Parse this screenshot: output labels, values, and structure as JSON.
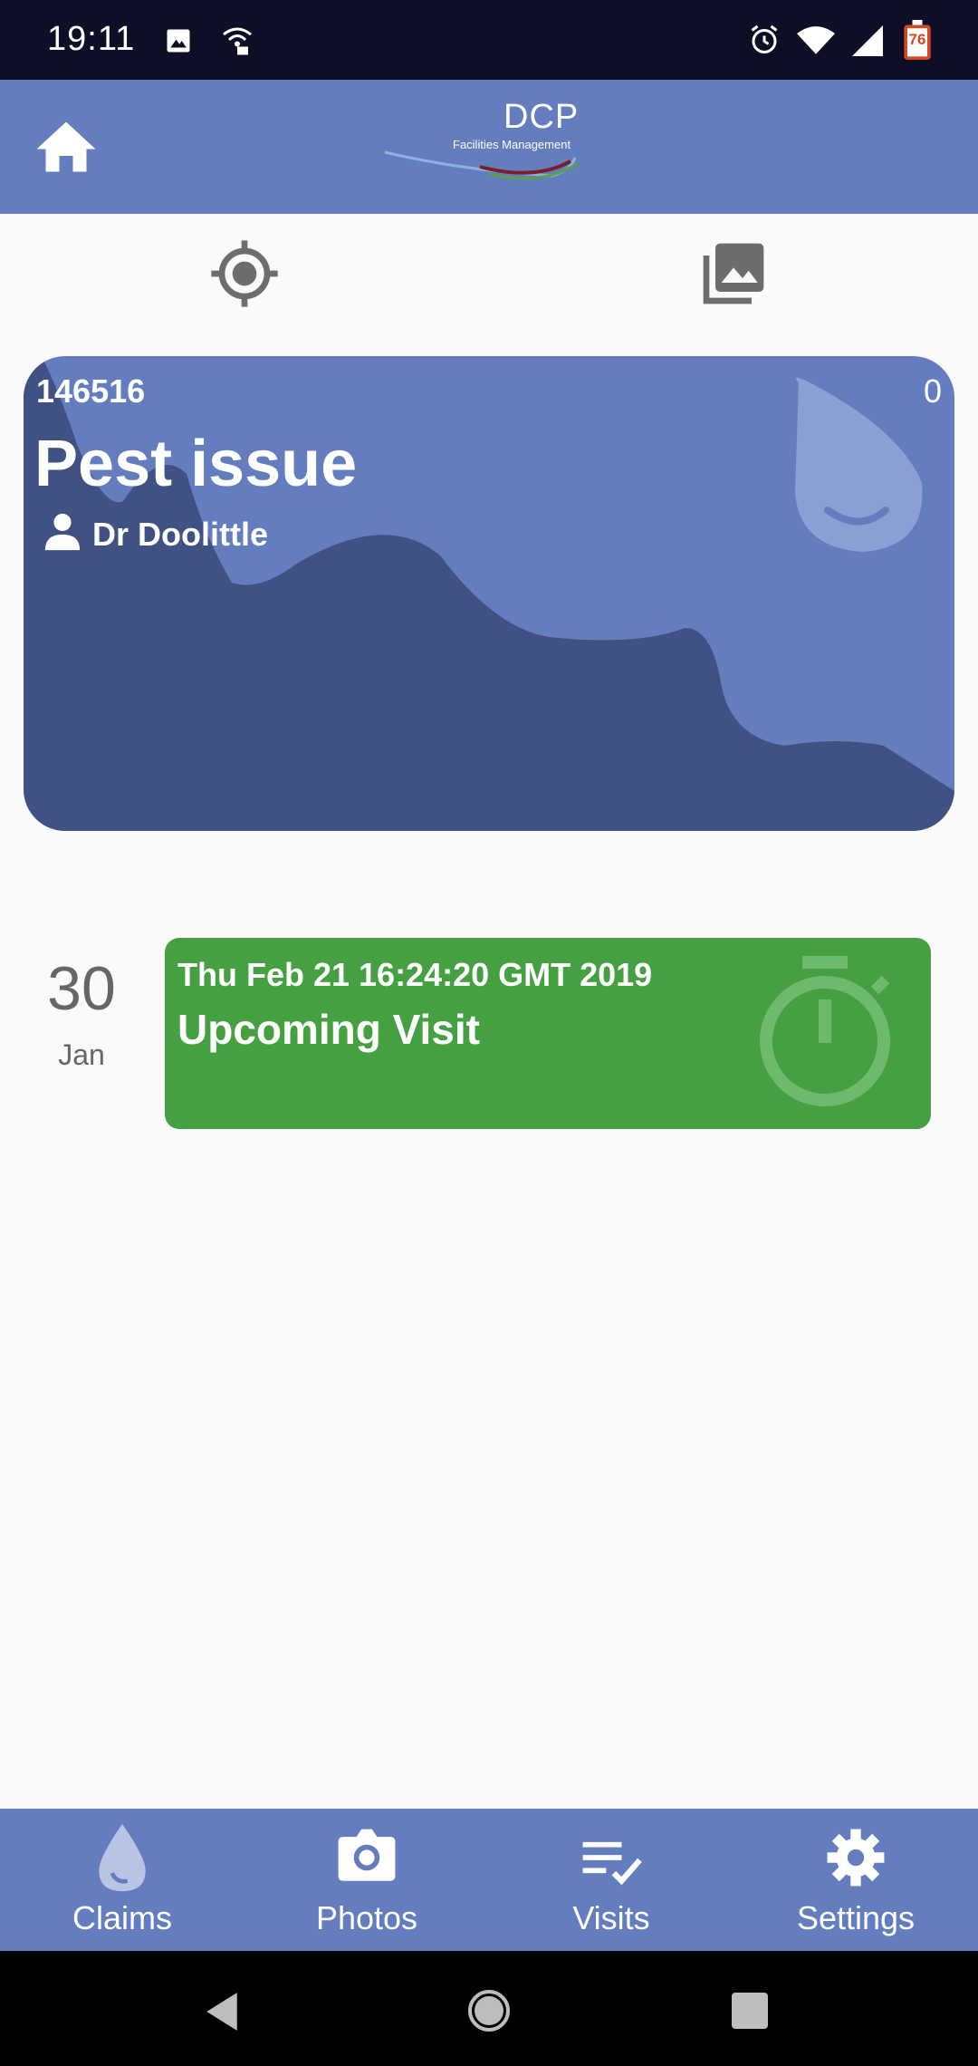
{
  "status_bar": {
    "time": "19:11",
    "battery_level": "76",
    "icons": [
      "image-icon",
      "wifi-calling-icon",
      "alarm-icon",
      "wifi-icon",
      "signal-icon",
      "battery-icon"
    ]
  },
  "app_bar": {
    "home_icon": "home-icon",
    "logo_title": "DCP",
    "logo_subtitle": "Facilities Management"
  },
  "toolbar": {
    "icons": [
      "gps-target-icon",
      "photo-library-icon"
    ]
  },
  "claim": {
    "id": "146516",
    "count": "0",
    "title": "Pest issue",
    "person": "Dr Doolittle",
    "icons": [
      "person-icon",
      "water-drop-icon"
    ]
  },
  "visit": {
    "day": "30",
    "month": "Jan",
    "date_text": "Thu Feb 21 16:24:20 GMT 2019",
    "title": "Upcoming Visit",
    "icon": "timer-icon"
  },
  "bottom_nav": {
    "items": [
      {
        "label": "Claims",
        "icon": "water-drop-icon"
      },
      {
        "label": "Photos",
        "icon": "camera-icon"
      },
      {
        "label": "Visits",
        "icon": "checklist-icon"
      },
      {
        "label": "Settings",
        "icon": "gear-icon"
      }
    ]
  },
  "colors": {
    "app_bar": "#647dbf",
    "card_dark": "#405283",
    "visit_green": "#45a041",
    "status_bar": "#0e0f26"
  }
}
